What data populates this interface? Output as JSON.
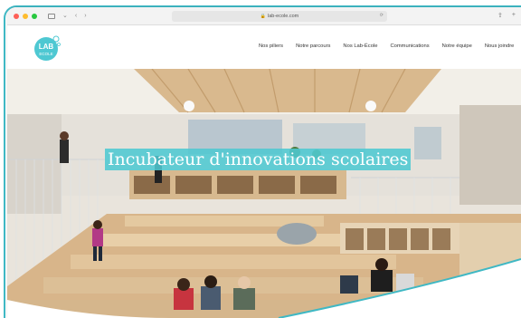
{
  "browser": {
    "url": "lab-ecole.com",
    "nav_back": "‹",
    "nav_forward": "›",
    "share_icon": "share-icon",
    "new_tab": "+"
  },
  "site": {
    "logo_text_top": "LAB",
    "logo_text_bottom": "ECOLE",
    "nav": [
      "Nos piliers",
      "Notre parcours",
      "Nos Lab-École",
      "Communications",
      "Notre équipe",
      "Nous joindre"
    ]
  },
  "hero": {
    "title": "Incubateur d'innovations scolaires"
  },
  "colors": {
    "accent": "#3fb8c4",
    "title_bg": "#4ec8d2"
  }
}
